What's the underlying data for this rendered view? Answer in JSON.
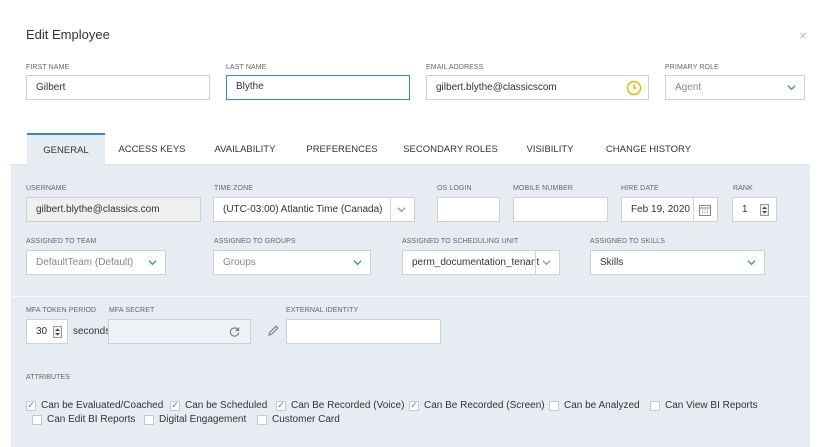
{
  "dialog": {
    "title": "Edit Employee",
    "close_glyph": "×"
  },
  "header_fields": {
    "first_name": {
      "label": "FIRST NAME",
      "value": "Gilbert"
    },
    "last_name": {
      "label": "LAST NAME",
      "value": "Blythe"
    },
    "email": {
      "label": "EMAIL ADDRESS",
      "value": "gilbert.blythe@classicscom"
    },
    "primary_role": {
      "label": "PRIMARY ROLE",
      "value": "Agent"
    }
  },
  "tabs": [
    {
      "label": "GENERAL",
      "active": true
    },
    {
      "label": "ACCESS KEYS"
    },
    {
      "label": "AVAILABILITY"
    },
    {
      "label": "PREFERENCES"
    },
    {
      "label": "SECONDARY ROLES"
    },
    {
      "label": "VISIBILITY"
    },
    {
      "label": "CHANGE HISTORY"
    }
  ],
  "general": {
    "username": {
      "label": "USERNAME",
      "value": "gilbert.blythe@classics.com"
    },
    "time_zone": {
      "label": "TIME ZONE",
      "value": "(UTC-03:00) Atlantic Time (Canada)"
    },
    "os_login": {
      "label": "OS LOGIN",
      "value": ""
    },
    "mobile_number": {
      "label": "MOBILE NUMBER",
      "value": ""
    },
    "hire_date": {
      "label": "HIRE DATE",
      "value": "Feb 19, 2020"
    },
    "rank": {
      "label": "RANK",
      "value": "1"
    },
    "team": {
      "label": "ASSIGNED TO TEAM",
      "value": "DefaultTeam (Default)"
    },
    "groups": {
      "label": "ASSIGNED TO GROUPS",
      "placeholder": "Groups"
    },
    "scheduling_unit": {
      "label": "ASSIGNED TO SCHEDULING UNIT",
      "value": "perm_documentation_tenant"
    },
    "skills": {
      "label": "ASSIGNED TO SKILLS",
      "value": "Skills"
    },
    "mfa_token_period": {
      "label": "MFA TOKEN PERIOD",
      "value": "30",
      "unit": "seconds"
    },
    "mfa_secret": {
      "label": "MFA SECRET",
      "value": ""
    },
    "external_identity": {
      "label": "EXTERNAL IDENTITY",
      "value": ""
    }
  },
  "attributes": {
    "label": "ATTRIBUTES",
    "items": [
      {
        "label": "Can be Evaluated/Coached",
        "checked": true
      },
      {
        "label": "Can be Scheduled",
        "checked": true
      },
      {
        "label": "Can Be Recorded (Voice)",
        "checked": true
      },
      {
        "label": "Can Be Recorded (Screen)",
        "checked": true
      },
      {
        "label": "Can be Analyzed",
        "checked": false
      },
      {
        "label": "Can View BI Reports",
        "checked": false
      },
      {
        "label": "Can Edit BI Reports",
        "checked": false
      },
      {
        "label": "Digital Engagement",
        "checked": false
      },
      {
        "label": "Customer Card",
        "checked": false
      }
    ],
    "check_glyph": "✓"
  },
  "colors": {
    "accent": "#3a86c8",
    "clock": "#e6b800",
    "panel": "#e6ecf2"
  }
}
